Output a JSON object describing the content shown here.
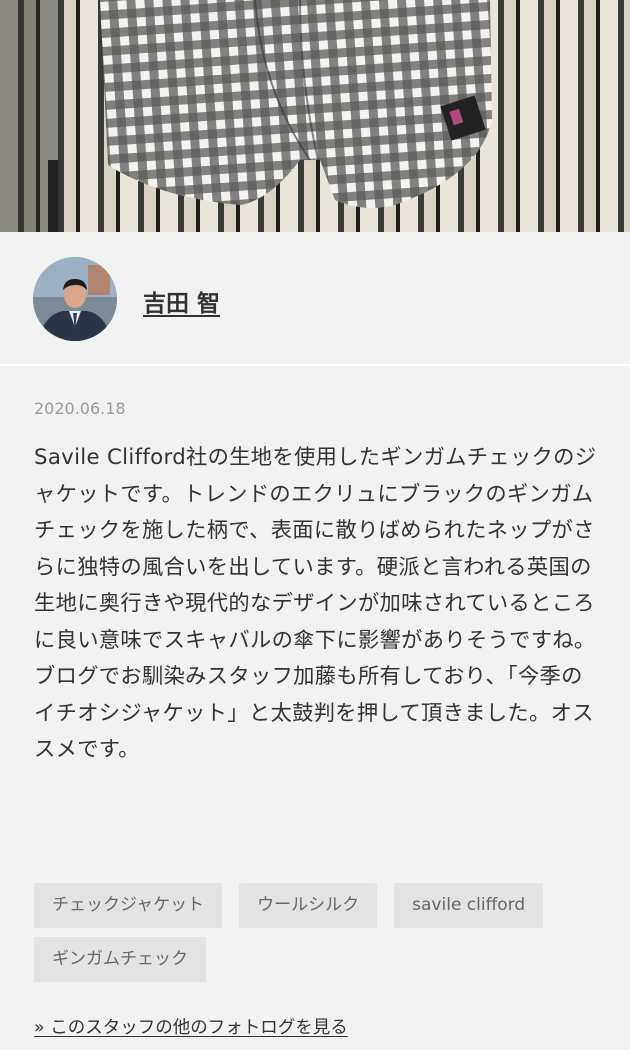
{
  "post": {
    "date": "2020.06.18",
    "body": "Savile Clifford社の生地を使用したギンガムチェックのジャケットです。トレンドのエクリュにブラックのギンガムチェックを施した柄で、表面に散りばめられたネップがさらに独特の風合いを出しています。硬派と言われる英国の生地に奥行きや現代的なデザインが加味されているところに良い意味でスキャバルの傘下に影響がありそうですね。ブログでお馴染みスタッフ加藤も所有しており、「今季のイチオシジャケット」と太鼓判を押して頂きました。オススメです。"
  },
  "author": {
    "name": "吉田 智"
  },
  "tags": [
    "チェックジャケット",
    "ウールシルク",
    "savile clifford",
    "ギンガムチェック"
  ],
  "links": {
    "more_photologs": "» このスタッフの他のフォトログを見る"
  },
  "colors": {
    "background": "#f2f2f2",
    "tag_background": "#e3e3e3",
    "text": "#333333",
    "date": "#999999"
  }
}
